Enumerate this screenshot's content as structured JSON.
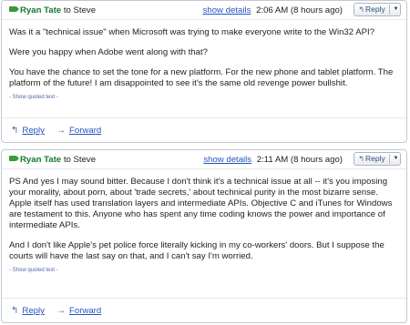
{
  "messages": [
    {
      "sender": "Ryan Tate",
      "to_prefix": "to",
      "recipient": "Steve",
      "details_link": "show details",
      "timestamp": "2:06 AM (8 hours ago)",
      "reply_label": "Reply",
      "paragraphs": [
        "Was it a \"technical issue\" when Microsoft was trying to make everyone write to the Win32 API?",
        "Were you happy when Adobe went along with that?",
        "You have the chance to set the tone for  a new platform. For the new phone and tablet platform. The platform of the future! I am disappointed to see it's the same old revenge power bullshit."
      ],
      "quoted_text": "- Show quoted text -",
      "footer_reply": "Reply",
      "footer_forward": "Forward"
    },
    {
      "sender": "Ryan Tate",
      "to_prefix": "to",
      "recipient": "Steve",
      "details_link": "show details",
      "timestamp": "2:11 AM (8 hours ago)",
      "reply_label": "Reply",
      "paragraphs": [
        "PS And yes I may sound bitter. Because I don't think it's a technical issue at all -- it's you imposing your morality, about porn, about 'trade secrets,' about technical purity in the most bizarre sense. Apple itself has used translation layers and intermediate APIs. Objective C and iTunes for Windows are testament to this. Anyone who has spent any time coding knows the power and importance of intermediate APIs.",
        "And I don't like Apple's pet police force literally kicking in my co-workers' doors. But I suppose the courts will have the last say on that, and I can't say I'm worried."
      ],
      "quoted_text": "- Show quoted text -",
      "footer_reply": "Reply",
      "footer_forward": "Forward"
    }
  ]
}
